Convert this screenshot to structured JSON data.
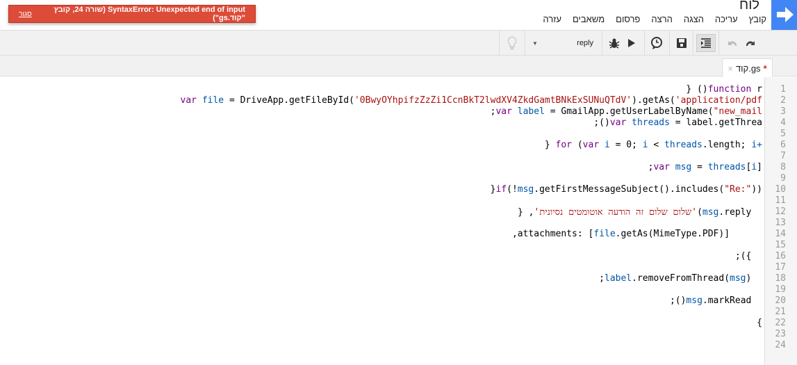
{
  "app": {
    "title": "לוח",
    "logo_icon": "arrow-right-icon",
    "accent": "#4285f4"
  },
  "menu": [
    "קובץ",
    "עריכה",
    "הצגה",
    "הרצה",
    "פרסום",
    "משאבים",
    "עזרה"
  ],
  "error": {
    "message": "SyntaxError: Unexpected end of input (שורה 24, קובץ \"קוד.gs\")",
    "close": "סגור",
    "color": "#dd4b39"
  },
  "toolbar": {
    "function_select": "reply",
    "icons": [
      "undo-icon",
      "redo-icon",
      "indent-icon",
      "save-icon",
      "triggers-icon",
      "run-icon",
      "debug-icon",
      "dropdown-icon",
      "lightbulb-icon"
    ]
  },
  "tab": {
    "label": "קוד.gs",
    "modified": "*",
    "close": "×"
  },
  "lines": [
    [
      [
        "} ()",
        "d"
      ],
      [
        "function",
        "k"
      ],
      [
        " r",
        "d"
      ]
    ],
    [
      [
        "var ",
        "k"
      ],
      [
        "file",
        "v"
      ],
      [
        " = DriveApp.getFileById(",
        "d"
      ],
      [
        "'0BwyOYhpifzZzZi1CcnBkT2lwdXV4ZkdGamtBNkExSUNuQTdV'",
        "s"
      ],
      [
        ").getAs(",
        "d"
      ],
      [
        "'application/pdf",
        "s"
      ]
    ],
    [
      [
        ";",
        "d"
      ],
      [
        "var ",
        "k"
      ],
      [
        "label",
        "v"
      ],
      [
        " = GmailApp.getUserLabelByName(",
        "d"
      ],
      [
        "\"new_mail",
        "s"
      ]
    ],
    [
      [
        ";()",
        "d"
      ],
      [
        "var ",
        "k"
      ],
      [
        "threads",
        "v"
      ],
      [
        " = label.getThrea",
        "d"
      ]
    ],
    [],
    [
      [
        "} ",
        "d"
      ],
      [
        "for",
        "k"
      ],
      [
        " (",
        "d"
      ],
      [
        "var ",
        "k"
      ],
      [
        "i",
        "v"
      ],
      [
        " = 0; ",
        "d"
      ],
      [
        "i",
        "v"
      ],
      [
        " < ",
        "d"
      ],
      [
        "threads",
        "v"
      ],
      [
        ".length; ",
        "d"
      ],
      [
        "i+",
        "v"
      ]
    ],
    [],
    [
      [
        ";",
        "d"
      ],
      [
        "var ",
        "k"
      ],
      [
        "msg",
        "v"
      ],
      [
        " = ",
        "d"
      ],
      [
        "threads",
        "v"
      ],
      [
        "[",
        "d"
      ],
      [
        "i",
        "v"
      ],
      [
        "]",
        "d"
      ]
    ],
    [],
    [
      [
        "}",
        "d"
      ],
      [
        "if",
        "k"
      ],
      [
        "(!",
        "d"
      ],
      [
        "msg",
        "v"
      ],
      [
        ".getFirstMessageSubject().includes(",
        "d"
      ],
      [
        "\"Re:\"",
        "s"
      ],
      [
        "))",
        "d"
      ]
    ],
    [],
    [
      [
        "} ,",
        "d"
      ],
      [
        "'שלום שלום זה הודעה אוטומטים נסיונית'",
        "s"
      ],
      [
        "(",
        "d"
      ],
      [
        "msg",
        "v"
      ],
      [
        ".reply  ",
        "d"
      ]
    ],
    [],
    [
      [
        ",attachments: [",
        "d"
      ],
      [
        "file",
        "v"
      ],
      [
        ".getAs(MimeType.PDF)]      ",
        "d"
      ]
    ],
    [],
    [
      [
        ";({  ",
        "d"
      ]
    ],
    [],
    [
      [
        ";",
        "d"
      ],
      [
        "label",
        "v"
      ],
      [
        ".removeFromThread(",
        "d"
      ],
      [
        "msg",
        "v"
      ],
      [
        ")  ",
        "d"
      ]
    ],
    [],
    [
      [
        ";()",
        "d"
      ],
      [
        "msg",
        "v"
      ],
      [
        ".markRead  ",
        "d"
      ]
    ],
    [],
    [
      [
        "{",
        "d"
      ]
    ],
    [],
    []
  ]
}
